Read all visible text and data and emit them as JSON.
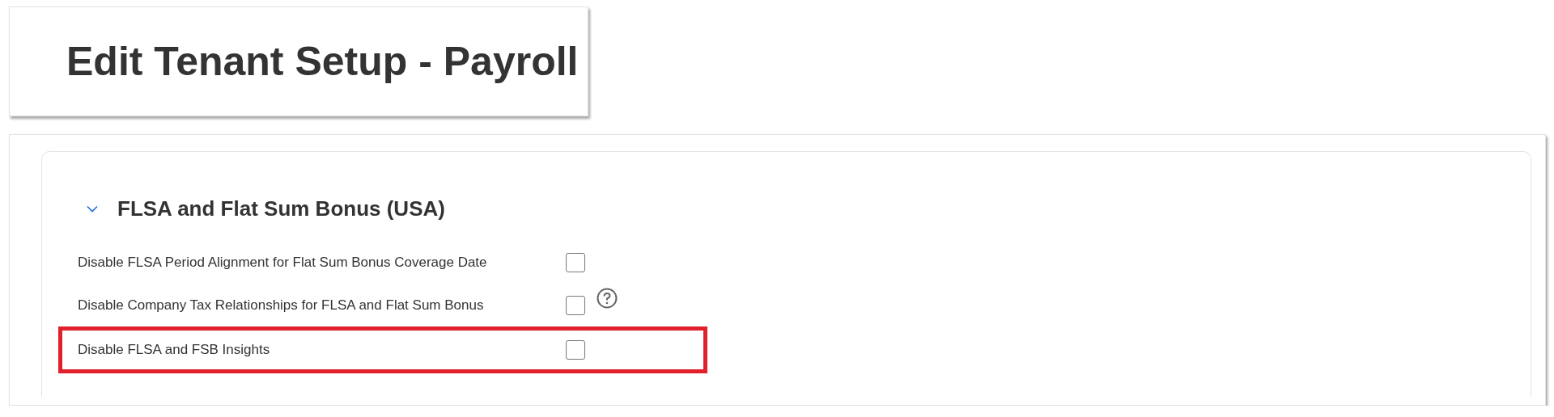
{
  "page_title": "Edit Tenant Setup - Payroll",
  "section": {
    "title": "FLSA and Flat Sum Bonus (USA)",
    "expanded": true,
    "settings": [
      {
        "label": "Disable FLSA Period Alignment for Flat Sum Bonus Coverage Date",
        "checked": false,
        "help": false,
        "highlighted": false
      },
      {
        "label": "Disable Company Tax Relationships for FLSA and Flat Sum Bonus",
        "checked": false,
        "help": true,
        "highlighted": false
      },
      {
        "label": "Disable FLSA and FSB Insights",
        "checked": false,
        "help": false,
        "highlighted": true
      }
    ]
  }
}
